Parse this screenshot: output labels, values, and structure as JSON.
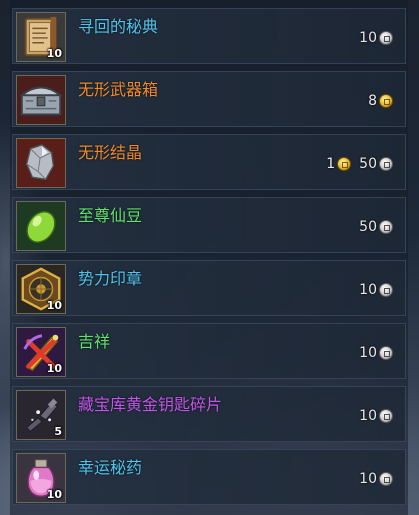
{
  "colors": {
    "name_blue": "#4fc3ec",
    "name_orange": "#f08a2a",
    "name_green": "#5ee36a",
    "name_purple": "#c056e8",
    "price_text": "#e8e8e8"
  },
  "items": [
    {
      "name": "寻回的秘典",
      "qty": "10",
      "icon": "ancient-tome-icon",
      "price": [
        {
          "amount": "10",
          "currency": "silver-coin-icon"
        }
      ]
    },
    {
      "name": "无形武器箱",
      "qty": "",
      "icon": "weapon-chest-icon",
      "price": [
        {
          "amount": "8",
          "currency": "gold-coin-icon"
        }
      ]
    },
    {
      "name": "无形结晶",
      "qty": "",
      "icon": "crystal-icon",
      "price": [
        {
          "amount": "1",
          "currency": "gold-coin-icon"
        },
        {
          "amount": "50",
          "currency": "silver-coin-icon"
        }
      ]
    },
    {
      "name": "至尊仙豆",
      "qty": "",
      "icon": "green-bean-icon",
      "price": [
        {
          "amount": "50",
          "currency": "silver-coin-icon"
        }
      ]
    },
    {
      "name": "势力印章",
      "qty": "10",
      "icon": "faction-seal-icon",
      "price": [
        {
          "amount": "10",
          "currency": "silver-coin-icon"
        }
      ]
    },
    {
      "name": "吉祥",
      "qty": "10",
      "icon": "lucky-charm-icon",
      "price": [
        {
          "amount": "10",
          "currency": "silver-coin-icon"
        }
      ]
    },
    {
      "name": "藏宝库黄金钥匙碎片",
      "qty": "5",
      "icon": "key-fragment-icon",
      "price": [
        {
          "amount": "10",
          "currency": "silver-coin-icon"
        }
      ]
    },
    {
      "name": "幸运秘药",
      "qty": "10",
      "icon": "potion-icon",
      "price": [
        {
          "amount": "10",
          "currency": "silver-coin-icon"
        }
      ]
    }
  ]
}
